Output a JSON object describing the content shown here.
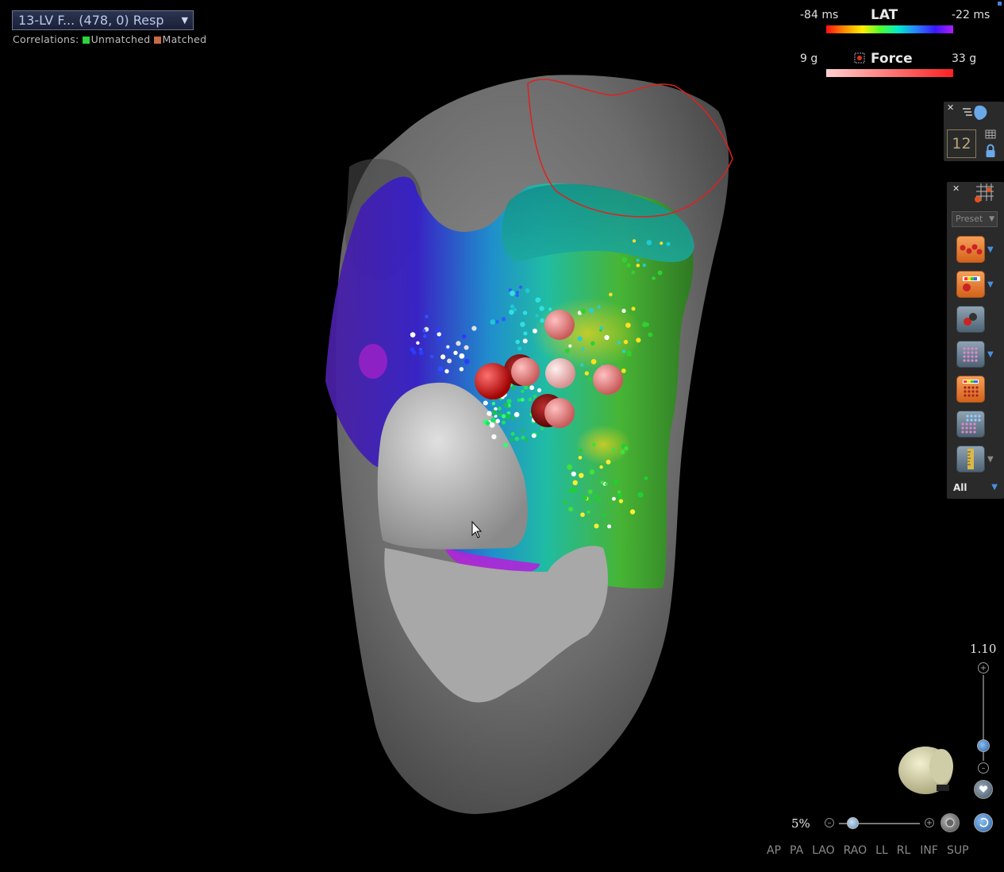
{
  "map_selector": {
    "label": "13-LV F... (478, 0) Resp"
  },
  "correlations": {
    "label": "Correlations:",
    "unmatched": "Unmatched",
    "matched": "Matched"
  },
  "legend": {
    "lat": {
      "min": "-84 ms",
      "title": "LAT",
      "max": "-22 ms"
    },
    "force": {
      "min": "9 g",
      "title": "Force",
      "max": "33 g"
    }
  },
  "right_panel": {
    "box_number": "12",
    "preset": "Preset",
    "filter": "All"
  },
  "zoom": {
    "value": "1.10",
    "opacity": "5%"
  },
  "views": [
    "AP",
    "PA",
    "LAO",
    "RAO",
    "LL",
    "RL",
    "INF",
    "SUP"
  ],
  "colors": {
    "lat_min": "#ff1010",
    "lat_max": "#b01cff",
    "force_min": "#ffd0d0",
    "force_max": "#ff2020"
  },
  "icons": [
    "heart-view-icon",
    "grid-icon",
    "lock-icon",
    "points-icon",
    "ablation-tags-icon",
    "tag-icon",
    "dots-grid-icon",
    "color-grid-icon",
    "blue-grid-icon",
    "ruler-icon",
    "heart-orientation-icon"
  ]
}
